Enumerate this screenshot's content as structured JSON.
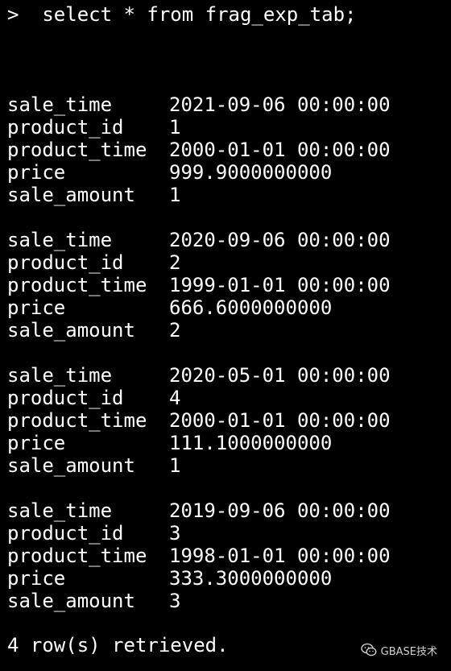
{
  "terminal": {
    "command": ">  select * from frag_exp_tab;",
    "records": [
      {
        "fields": [
          {
            "name": "sale_time",
            "value": "2021-09-06 00:00:00"
          },
          {
            "name": "product_id",
            "value": "1"
          },
          {
            "name": "product_time",
            "value": "2000-01-01 00:00:00"
          },
          {
            "name": "price",
            "value": "999.9000000000"
          },
          {
            "name": "sale_amount",
            "value": "1"
          }
        ]
      },
      {
        "fields": [
          {
            "name": "sale_time",
            "value": "2020-09-06 00:00:00"
          },
          {
            "name": "product_id",
            "value": "2"
          },
          {
            "name": "product_time",
            "value": "1999-01-01 00:00:00"
          },
          {
            "name": "price",
            "value": "666.6000000000"
          },
          {
            "name": "sale_amount",
            "value": "2"
          }
        ]
      },
      {
        "fields": [
          {
            "name": "sale_time",
            "value": "2020-05-01 00:00:00"
          },
          {
            "name": "product_id",
            "value": "4"
          },
          {
            "name": "product_time",
            "value": "2000-01-01 00:00:00"
          },
          {
            "name": "price",
            "value": "111.1000000000"
          },
          {
            "name": "sale_amount",
            "value": "1"
          }
        ]
      },
      {
        "fields": [
          {
            "name": "sale_time",
            "value": "2019-09-06 00:00:00"
          },
          {
            "name": "product_id",
            "value": "3"
          },
          {
            "name": "product_time",
            "value": "1998-01-01 00:00:00"
          },
          {
            "name": "price",
            "value": "333.3000000000"
          },
          {
            "name": "sale_amount",
            "value": "3"
          }
        ]
      }
    ],
    "status": "4 row(s) retrieved."
  },
  "watermark": {
    "icon": "wechat-icon",
    "text": "GBASE技术"
  },
  "colors": {
    "background": "#000000",
    "text": "#ffffff",
    "watermark": "#d0d0d0"
  }
}
